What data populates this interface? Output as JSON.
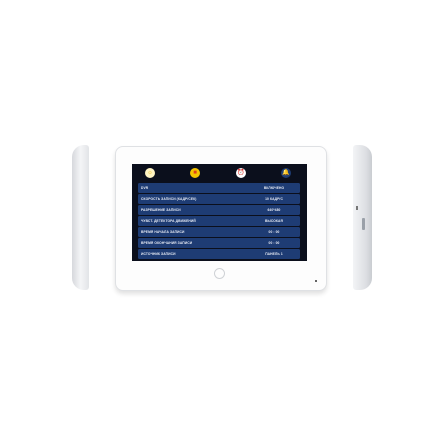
{
  "toolbar": {
    "icons": [
      {
        "name": "brightness-icon",
        "glyph": "☼",
        "bg": "#fff4c4",
        "fg": "#e8b400"
      },
      {
        "name": "video-record-icon",
        "glyph": "■",
        "bg": "#f5c400",
        "fg": "#e0401a"
      },
      {
        "name": "alarm-clock-icon",
        "glyph": "⏰",
        "bg": "#ffffff",
        "fg": "#333333"
      },
      {
        "name": "bell-icon",
        "glyph": "🔔",
        "bg": "#1e3c74",
        "fg": "#ffffff"
      }
    ]
  },
  "settings": [
    {
      "label": "DVR",
      "value": "ВКЛЮЧЕНО"
    },
    {
      "label": "СКОРОСТЬ ЗАПИСИ (КАДР/СЕК)",
      "value": "10   КАДР/С"
    },
    {
      "label": "РАЗРЕШЕНИЕ ЗАПИСИ",
      "value": "640*480"
    },
    {
      "label": "ЧУВСТ. ДЕТЕКТОРА ДВИЖЕНИЙ",
      "value": "ВЫСОКАЯ"
    },
    {
      "label": "ВРЕМЯ НАЧАЛА ЗАПИСИ",
      "value": "00   :   00"
    },
    {
      "label": "ВРЕМЯ ОКОНЧАНИЯ ЗАПИСИ",
      "value": "00   :   00"
    },
    {
      "label": "ИСТОЧНИК ЗАПИСИ",
      "value": "ПАНЕЛЬ 1"
    }
  ]
}
